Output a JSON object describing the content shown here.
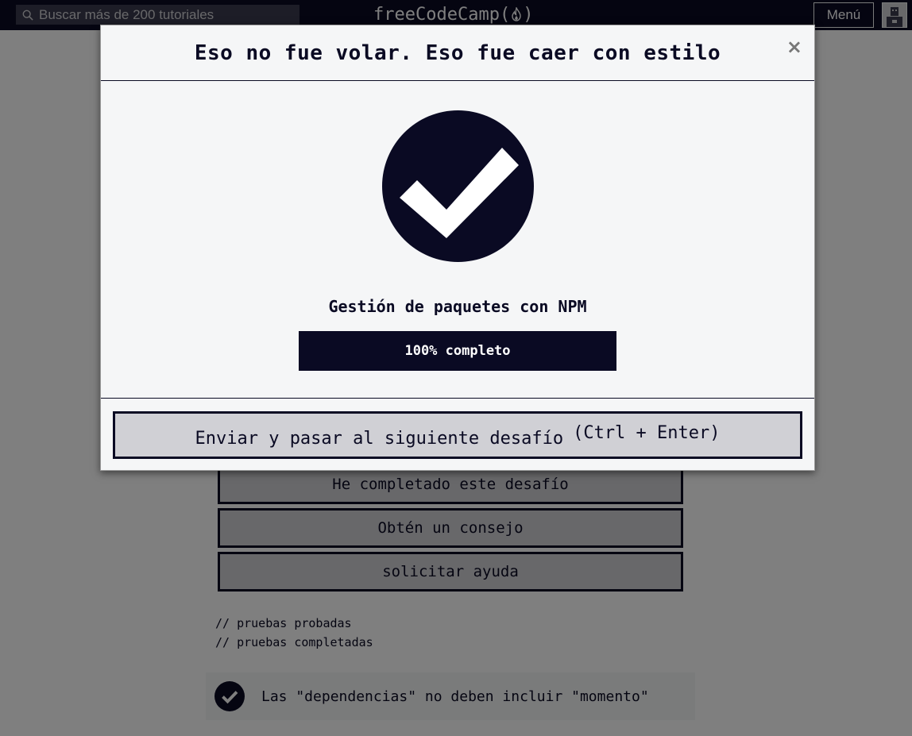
{
  "navbar": {
    "search_placeholder": "Buscar más de 200 tutoriales",
    "logo_text": "freeCodeCamp",
    "logo_open": "(",
    "logo_close": ")",
    "menu_label": "Menú"
  },
  "background": {
    "buttons": [
      {
        "label": "He completado este desafío"
      },
      {
        "label": "Obtén un consejo"
      },
      {
        "label": "solicitar ayuda"
      }
    ],
    "test_lines": [
      "// pruebas probadas",
      "// pruebas completadas"
    ],
    "test_result": "Las \"dependencias\" no deben incluir \"momento\""
  },
  "modal": {
    "title": "Eso no fue volar. Eso fue caer con estilo",
    "close_label": "×",
    "cert_title": "Gestión de paquetes con NPM",
    "progress_percent": 100,
    "progress_text": "100% completo",
    "submit_label": "Enviar y pasar al siguiente desafío",
    "submit_shortcut": "(Ctrl + Enter)"
  },
  "colors": {
    "navy": "#0a0a23",
    "light_gray": "#f5f6f7",
    "button_gray": "#d0d0d5",
    "search_bg": "#3b3b4f"
  }
}
